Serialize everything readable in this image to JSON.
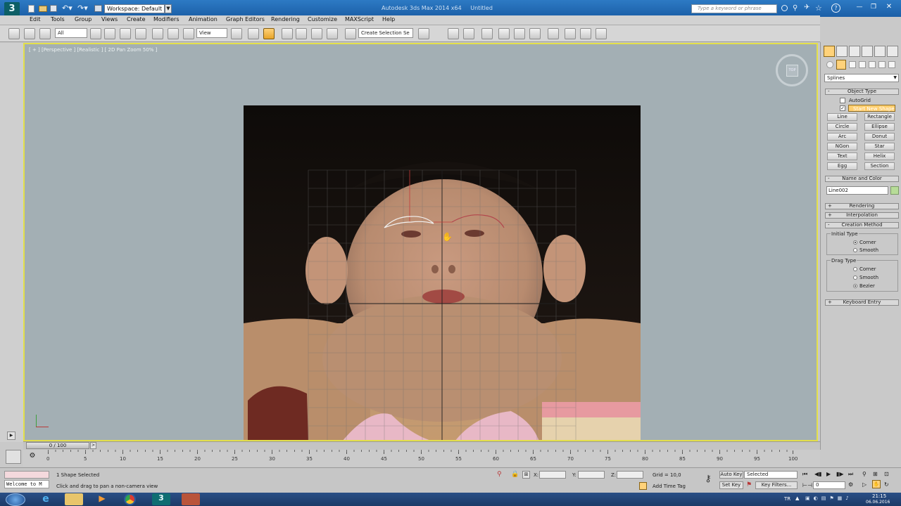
{
  "titlebar": {
    "workspace": "Workspace: Default",
    "title": "Autodesk 3ds Max 2014 x64",
    "doc": "Untitled",
    "search_placeholder": "Type a keyword or phrase"
  },
  "menu": [
    "Edit",
    "Tools",
    "Group",
    "Views",
    "Create",
    "Modifiers",
    "Animation",
    "Graph Editors",
    "Rendering",
    "Customize",
    "MAXScript",
    "Help"
  ],
  "toolbar": {
    "filter": "All",
    "ref_coord": "View",
    "selection_set": "Create Selection Se"
  },
  "viewport": {
    "label": "[ + ] [Perspective ] [Realistic ] [ 2D Pan Zoom 50% ]",
    "viewcube": "TOP"
  },
  "panel": {
    "category": "Splines",
    "object_type": "Object Type",
    "autogrid": "AutoGrid",
    "start_new_shape": "Start New Shape",
    "buttons": [
      "Line",
      "Rectangle",
      "Circle",
      "Ellipse",
      "Arc",
      "Donut",
      "NGon",
      "Star",
      "Text",
      "Helix",
      "Egg",
      "Section"
    ],
    "name_and_color": "Name and Color",
    "object_name": "Line002",
    "color": "#b7dc98",
    "rendering": "Rendering",
    "interpolation": "Interpolation",
    "creation_method": "Creation Method",
    "initial_type": "Initial Type",
    "initial_corner": "Corner",
    "initial_smooth": "Smooth",
    "drag_type": "Drag Type",
    "drag_corner": "Corner",
    "drag_smooth": "Smooth",
    "drag_bezier": "Bezier",
    "keyboard_entry": "Keyboard Entry"
  },
  "timeline": {
    "frame": "0 / 100",
    "ticks": [
      "0",
      "5",
      "10",
      "15",
      "20",
      "25",
      "30",
      "35",
      "40",
      "45",
      "50",
      "55",
      "60",
      "65",
      "70",
      "75",
      "80",
      "85",
      "90",
      "95",
      "100"
    ]
  },
  "status": {
    "maxscript": "Welcome to M",
    "selection": "1 Shape Selected",
    "prompt": "Click and drag to pan a non-camera view",
    "x_label": "X:",
    "y_label": "Y:",
    "z_label": "Z:",
    "grid": "Grid = 10,0",
    "add_time_tag": "Add Time Tag",
    "auto_key": "Auto Key",
    "set_key": "Set Key",
    "selected": "Selected",
    "key_filters": "Key Filters...",
    "frame_field": "0"
  },
  "taskbar": {
    "lang": "TR",
    "time": "21:15",
    "date": "06.06.2016"
  }
}
